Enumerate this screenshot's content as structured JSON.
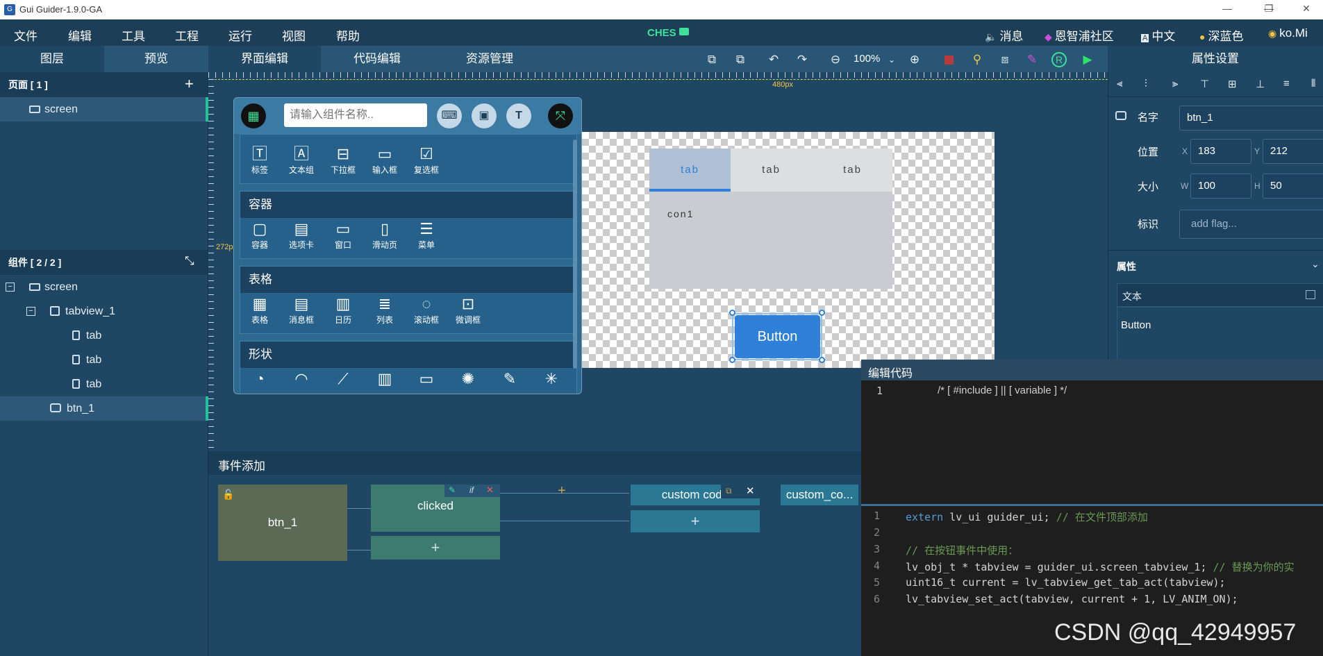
{
  "window": {
    "title": "Gui Guider-1.9.0-GA",
    "minimize": "—",
    "maximize": "❐",
    "close": "✕"
  },
  "menu": {
    "items": [
      "文件",
      "编辑",
      "工具",
      "工程",
      "运行",
      "视图",
      "帮助"
    ],
    "project": "CHES",
    "right": [
      {
        "icon": "speaker-icon",
        "label": "消息"
      },
      {
        "icon": "community-icon",
        "label": "恩智浦社区"
      },
      {
        "icon": "language-icon",
        "label": "中文"
      },
      {
        "icon": "palette-icon",
        "label": "深蓝色"
      },
      {
        "icon": "user-icon",
        "label": "ko.Mi"
      }
    ]
  },
  "tabs": {
    "left": [
      "图层",
      "预览"
    ],
    "center": [
      "界面编辑",
      "代码编辑",
      "资源管理"
    ],
    "zoom": "100%",
    "props_title": "属性设置"
  },
  "pages": {
    "header": "页面 [ 1 ]",
    "add": "+",
    "items": [
      "screen"
    ]
  },
  "components": {
    "header": "组件 [ 2 / 2 ]",
    "tree": [
      "screen",
      "tabview_1",
      "tab",
      "tab",
      "tab",
      "btn_1"
    ]
  },
  "canvas": {
    "ruler_top_label": "480px",
    "ruler_left_label": "272px",
    "tab_labels": [
      "tab",
      "tab",
      "tab"
    ],
    "tab_content": "con1",
    "button_label": "Button"
  },
  "palette": {
    "search_placeholder": "请输入组件名称..",
    "sections": [
      {
        "title": "",
        "items": [
          "标签",
          "文本组",
          "下拉框",
          "输入框",
          "复选框"
        ]
      },
      {
        "title": "容器",
        "items": [
          "容器",
          "选项卡",
          "窗口",
          "滑动页",
          "菜单"
        ]
      },
      {
        "title": "表格",
        "items": [
          "表格",
          "消息框",
          "日历",
          "列表",
          "滚动框",
          "微调框"
        ]
      },
      {
        "title": "形状",
        "items": [
          "",
          "",
          "",
          "",
          "",
          "",
          "",
          ""
        ]
      }
    ]
  },
  "properties": {
    "name_label": "名字",
    "name_value": "btn_1",
    "pos_label": "位置",
    "x_label": "X",
    "x_value": "183",
    "y_label": "Y",
    "y_value": "212",
    "size_label": "大小",
    "w_label": "W",
    "w_value": "100",
    "h_label": "H",
    "h_value": "50",
    "flag_label": "标识",
    "flag_placeholder": "add flag...",
    "attr_header": "属性",
    "text_label": "文本",
    "text_value": "Button"
  },
  "events": {
    "header": "事件添加",
    "widget": "btn_1",
    "trigger": "clicked",
    "trigger_if": "if",
    "plus": "+",
    "action": "custom code",
    "action2": "custom_co..."
  },
  "editor": {
    "header": "编辑代码",
    "top_line_no": "1",
    "top_line": "/* [ #include ] || [ variable ] */",
    "lines": [
      {
        "no": "1",
        "text": "extern lv_ui guider_ui; // 在文件顶部添加"
      },
      {
        "no": "2",
        "text": ""
      },
      {
        "no": "3",
        "text": "// 在按钮事件中使用："
      },
      {
        "no": "4",
        "text": "lv_obj_t * tabview = guider_ui.screen_tabview_1; // 替换为你的实"
      },
      {
        "no": "5",
        "text": "uint16_t current = lv_tabview_get_tab_act(tabview);"
      },
      {
        "no": "6",
        "text": "lv_tabview_set_act(tabview, current + 1, LV_ANIM_ON);"
      }
    ],
    "watermark": "CSDN @qq_42949957"
  },
  "colors": {
    "accent": "#1fc49a",
    "button": "#2f80d8",
    "menu_bg": "#1d3e57"
  }
}
